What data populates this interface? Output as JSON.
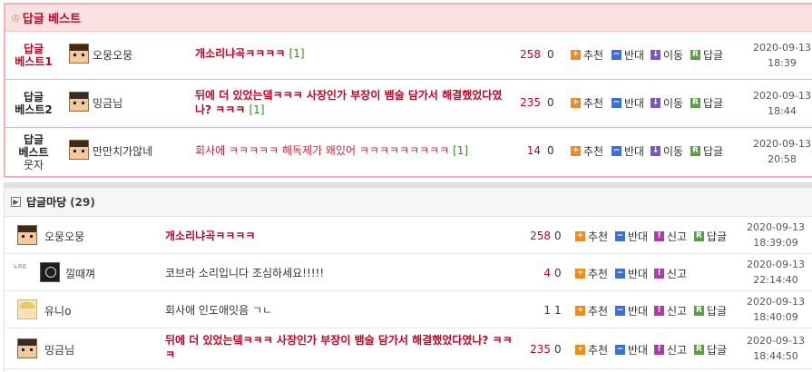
{
  "best": {
    "title": "답글 베스트",
    "rows": [
      {
        "rank_line1": "답글",
        "rank_line2": "베스트1",
        "nick": "오뭉오뭉",
        "title": "개소리냐곡ㅋㅋㅋㅋ",
        "comments": "[1]",
        "up": "258",
        "down": "0",
        "date": "2020-09-13",
        "time": "18:39"
      },
      {
        "rank_line1": "답글",
        "rank_line2": "베스트2",
        "nick": "밍금님",
        "title": "뒤에 더 있었는뎈ㅋㅋㅋ 사장인가 부장이 뱀술 담가서 해결했었다였나? ㅋㅋㅋ",
        "comments": "[1]",
        "up": "235",
        "down": "0",
        "date": "2020-09-13",
        "time": "18:44"
      },
      {
        "rank_line1": "답글",
        "rank_line2": "베스트",
        "rank_line3": "웃자",
        "nick": "만만치가않네",
        "title": "회사에 ㅋㅋㅋㅋㅋ 해독제가 왜있어 ㅋㅋㅋㅋㅋㅋㅋㅋㅋ",
        "comments": "[1]",
        "up": "14",
        "down": "0",
        "date": "2020-09-13",
        "time": "20:58"
      }
    ]
  },
  "actions": {
    "recommend": "추천",
    "oppose": "반대",
    "move": "이동",
    "reply": "답글",
    "report": "신고"
  },
  "madang": {
    "title": "답글마당",
    "count": "(29)",
    "re_label": "RE",
    "rows": [
      {
        "nick": "오뭉오뭉",
        "title": "개소리냐곡ㅋㅋㅋㅋ",
        "up": "258",
        "down": "0",
        "date": "2020-09-13",
        "time": "18:39:09"
      },
      {
        "nick": "낄때껴",
        "title": "코브라 소리입니다 조심하세요!!!!!",
        "up": "4",
        "down": "0",
        "date": "2020-09-13",
        "time": "22:14:40"
      },
      {
        "nick": "유니o",
        "title": "회사애 인도애잇음 ㄱㄴ",
        "up": "1",
        "down": "1",
        "date": "2020-09-13",
        "time": "18:40:09"
      },
      {
        "nick": "밍금님",
        "title": "뒤에 더 있었는뎈ㅋㅋㅋ 사장인가 부장이 뱀술 담가서 해결했었다였나? ㅋㅋㅋ",
        "up": "235",
        "down": "0",
        "date": "2020-09-13",
        "time": "18:44:50"
      }
    ]
  },
  "colors": {
    "accent_red": "#c80020",
    "best_header_bg": "#fbe1e1",
    "best_border": "#f2b3b3",
    "comment_green": "#3a8a18"
  }
}
